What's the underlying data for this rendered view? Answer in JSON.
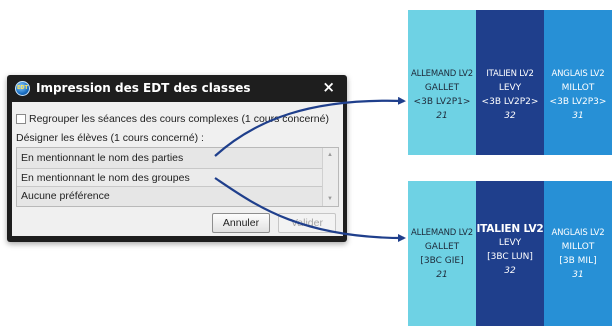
{
  "dialog": {
    "title": "Impression des EDT des classes",
    "app_icon_text": "EDT",
    "close_label": "×",
    "checkbox_label": "Regrouper les séances des cours complexes (1 cours concerné)",
    "checkbox_checked": false,
    "designate_label": "Désigner les élèves (1 cours concerné) :",
    "options": [
      "En mentionnant le nom des parties",
      "En mentionnant le nom des groupes",
      "Aucune préférence"
    ],
    "selected_option": "En mentionnant le nom des groupes",
    "cancel_label": "Annuler",
    "validate_label": "Valider"
  },
  "timetable_top": [
    {
      "subject": "ALLEMAND LV2",
      "teacher": "GALLET",
      "group": "<3B LV2P1>",
      "count": "21",
      "color": "#6ed2e4"
    },
    {
      "subject": "ITALIEN LV2",
      "teacher": "LEVY",
      "group": "<3B LV2P2>",
      "count": "32",
      "color": "#1f3f8c"
    },
    {
      "subject": "ANGLAIS LV2",
      "teacher": "MILLOT",
      "group": "<3B LV2P3>",
      "count": "31",
      "color": "#2790d6"
    }
  ],
  "timetable_bottom": [
    {
      "subject": "ALLEMAND LV2",
      "teacher": "GALLET",
      "group": "[3BC GIE]",
      "count": "21",
      "color": "#6ed2e4"
    },
    {
      "subject": "ITALIEN LV2",
      "teacher": "LEVY",
      "group": "[3BC LUN]",
      "count": "32",
      "color": "#1f3f8c"
    },
    {
      "subject": "ANGLAIS LV2",
      "teacher": "MILLOT",
      "group": "[3B MIL]",
      "count": "31",
      "color": "#2790d6"
    }
  ]
}
